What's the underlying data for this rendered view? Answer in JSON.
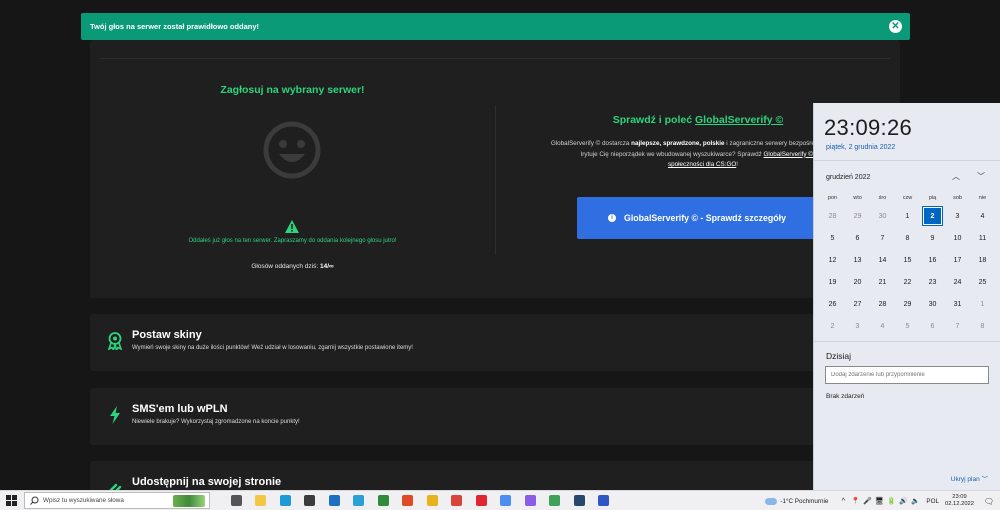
{
  "toast": {
    "message": "Twój głos na serwer został prawidłowo oddany!",
    "close_glyph": "✕"
  },
  "vote": {
    "title": "Zagłosuj na wybrany serwer!",
    "voted_message": "Oddałeś już głos na ten serwer. Zapraszamy do oddania kolejnego głosu jutro!",
    "votes_today_label": "Głosów oddanych dziś:",
    "votes_today_value": "14/∞"
  },
  "globalserverify": {
    "title_prefix": "Sprawdź i poleć ",
    "title_link": "GlobalServerify ©",
    "desc_line1_a": "GlobalServerify © dostarcza ",
    "desc_line1_b": "najlepsze, sprawdzone, polskie",
    "desc_line1_c": " i zagraniczne serwery bezpośrednio do Ciebie",
    "desc_line2_a": "Irytuje Cię nieporządek we wbudowanej wyszukiwarce? Sprawdź ",
    "desc_line2_b": "GlobalServerify © - do",
    "desc_line3": "społeczności dla CS:GO",
    "desc_line3_end": "!",
    "button_label": "GlobalServerify © - Sprawdź szczegóły",
    "button_icon": "i"
  },
  "cards": [
    {
      "title": "Postaw skiny",
      "desc": "Wymień swoje skiny na duże ilości punktów! Weź udział w losowaniu, zgarnij wszystkie postawione itemy!"
    },
    {
      "title": "SMS'em lub wPLN",
      "desc": "Niewiele brakuje? Wykorzystaj zgromadzone na koncie punkty!"
    },
    {
      "title": "Udostępnij na swojej stronie",
      "desc": ""
    }
  ],
  "calendar": {
    "time": "23:09:26",
    "date_full": "piątek, 2 grudnia 2022",
    "month_label": "grudzień 2022",
    "prev_glyph": "︿",
    "next_glyph": "﹀",
    "weekdays": [
      "pon",
      "wto",
      "śro",
      "czw",
      "pią",
      "sob",
      "nie"
    ],
    "weeks": [
      [
        {
          "d": "28",
          "out": true
        },
        {
          "d": "29",
          "out": true
        },
        {
          "d": "30",
          "out": true
        },
        {
          "d": "1"
        },
        {
          "d": "2",
          "today": true
        },
        {
          "d": "3"
        },
        {
          "d": "4"
        }
      ],
      [
        {
          "d": "5"
        },
        {
          "d": "6"
        },
        {
          "d": "7"
        },
        {
          "d": "8"
        },
        {
          "d": "9"
        },
        {
          "d": "10"
        },
        {
          "d": "11"
        }
      ],
      [
        {
          "d": "12"
        },
        {
          "d": "13"
        },
        {
          "d": "14"
        },
        {
          "d": "15"
        },
        {
          "d": "16"
        },
        {
          "d": "17"
        },
        {
          "d": "18"
        }
      ],
      [
        {
          "d": "19"
        },
        {
          "d": "20"
        },
        {
          "d": "21"
        },
        {
          "d": "22"
        },
        {
          "d": "23"
        },
        {
          "d": "24"
        },
        {
          "d": "25"
        }
      ],
      [
        {
          "d": "26"
        },
        {
          "d": "27"
        },
        {
          "d": "28"
        },
        {
          "d": "29"
        },
        {
          "d": "30"
        },
        {
          "d": "31"
        },
        {
          "d": "1",
          "out": true
        }
      ],
      [
        {
          "d": "2",
          "out": true
        },
        {
          "d": "3",
          "out": true
        },
        {
          "d": "4",
          "out": true
        },
        {
          "d": "5",
          "out": true
        },
        {
          "d": "6",
          "out": true
        },
        {
          "d": "7",
          "out": true
        },
        {
          "d": "8",
          "out": true
        }
      ]
    ],
    "today_label": "Dzisiaj",
    "event_placeholder": "Dodaj zdarzenie lub przypomnienie",
    "no_events": "Brak zdarzeń",
    "hide_plan": "Ukryj plan"
  },
  "taskbar": {
    "search_placeholder": "Wpisz tu wyszukiwane słowa",
    "apps": [
      {
        "name": "task-view-icon",
        "color": "#555555"
      },
      {
        "name": "file-explorer-icon",
        "color": "#f2c744"
      },
      {
        "name": "edge-icon",
        "color": "#1c9bd8"
      },
      {
        "name": "store-icon",
        "color": "#3b3b3b"
      },
      {
        "name": "mail-icon",
        "color": "#1d6fc4"
      },
      {
        "name": "app-l-icon",
        "color": "#2aa0d8"
      },
      {
        "name": "xbox-icon",
        "color": "#2e8b3a"
      },
      {
        "name": "office-icon",
        "color": "#e04b25"
      },
      {
        "name": "chrome-icon",
        "color": "#e8b21b"
      },
      {
        "name": "chrome-profile-icon",
        "color": "#d9443a"
      },
      {
        "name": "opera-icon",
        "color": "#e0262f"
      },
      {
        "name": "chrome-profile-2-icon",
        "color": "#4b8ef0"
      },
      {
        "name": "messenger-icon",
        "color": "#8b5ce6"
      },
      {
        "name": "chrome-profile-3-icon",
        "color": "#3da35a"
      },
      {
        "name": "steam-icon",
        "color": "#27476e"
      },
      {
        "name": "app-s-icon",
        "color": "#2e57c6"
      }
    ],
    "weather_text": "-1°C  Pochmurnie",
    "tray_up": "^",
    "tray_icons": [
      "📍",
      "🎤",
      "🖥",
      "🔋",
      "🔊",
      "🔈"
    ],
    "language": "POL",
    "time": "23:09",
    "date": "02.12.2022",
    "notification_glyph": "🗨"
  },
  "colors": {
    "accent_green": "#2ed47d",
    "toast_bg": "#0b9a78",
    "button_blue": "#2f6fe2",
    "calendar_today": "#0067c0"
  }
}
